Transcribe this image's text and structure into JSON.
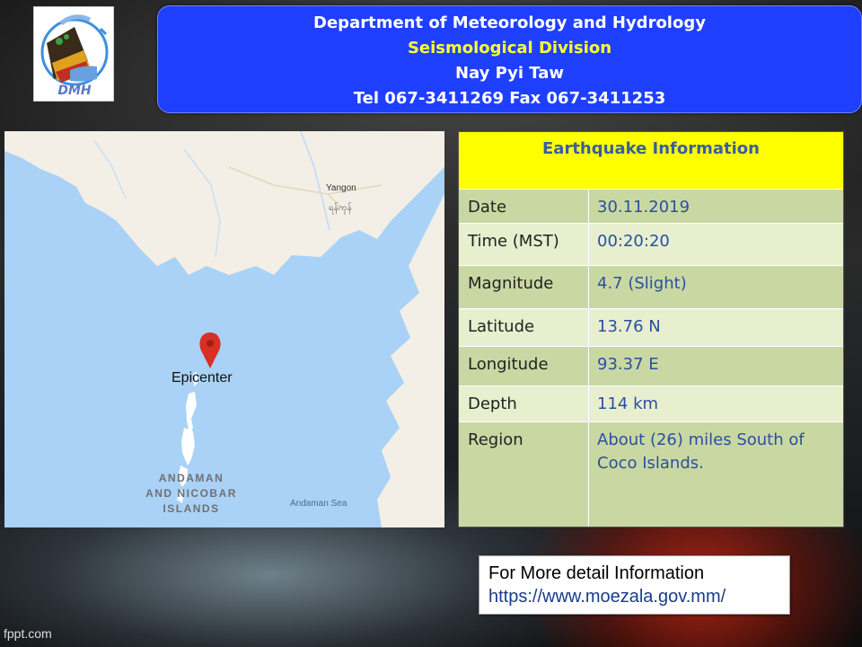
{
  "logo": {
    "text": "DMH"
  },
  "header": {
    "line1": "Department of Meteorology and Hydrology",
    "line2": "Seismological  Division",
    "line3": "Nay Pyi Taw",
    "line4": "Tel 067-3411269  Fax 067-3411253"
  },
  "map": {
    "labels": {
      "yangon": "Yangon",
      "yangon_local": "ရန်ကုန်",
      "epicenter": "Epicenter",
      "andaman_1": "ANDAMAN",
      "andaman_2": "AND NICOBAR",
      "andaman_3": "ISLANDS",
      "sea": "Andaman Sea"
    },
    "marker_icon": "map-pin-icon",
    "marker_color": "#d93025"
  },
  "info": {
    "title": "Earthquake Information",
    "rows": [
      {
        "key": "Date",
        "value": "30.11.2019"
      },
      {
        "key": "Time (MST)",
        "value": "00:20:20"
      },
      {
        "key": "Magnitude",
        "value": "4.7 (Slight)"
      },
      {
        "key": "Latitude",
        "value": "13.76 N"
      },
      {
        "key": "Longitude",
        "value": "93.37 E"
      },
      {
        "key": "Depth",
        "value": "114 km"
      },
      {
        "key": "Region",
        "value": "About (26)  miles South of Coco Islands."
      }
    ]
  },
  "detail": {
    "line1": "For More detail Information",
    "line2": "https://www.moezala.gov.mm/"
  },
  "footer": {
    "text": "fppt.com"
  },
  "colors": {
    "header_bg": "#1f3fff",
    "header_highlight": "#ffff33",
    "table_header_bg": "#ffff00",
    "table_value_text": "#2b4fa0"
  }
}
